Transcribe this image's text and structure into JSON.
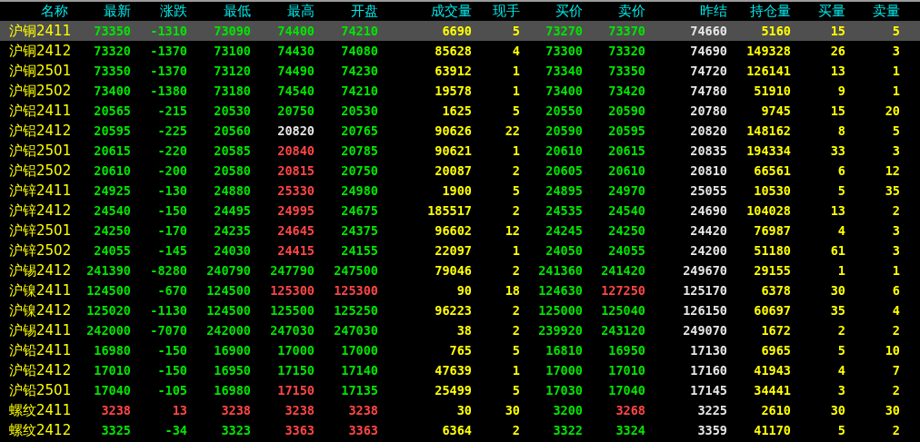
{
  "columns": [
    "名称",
    "最新",
    "涨跌",
    "最低",
    "最高",
    "开盘",
    "成交量",
    "现手",
    "买价",
    "卖价",
    "昨结",
    "持仓量",
    "买量",
    "卖量"
  ],
  "rows": [
    {
      "name": "沪铜2411",
      "selected": true,
      "last": {
        "value": "73350",
        "color": "#00e600"
      },
      "change": {
        "value": "-1310",
        "color": "#00e600"
      },
      "low": {
        "value": "73090",
        "color": "#00e600"
      },
      "high": {
        "value": "74400",
        "color": "#00e600"
      },
      "open": {
        "value": "74210",
        "color": "#00e600"
      },
      "volume": "6690",
      "last_vol": "5",
      "bid": {
        "value": "73270",
        "color": "#00e600"
      },
      "ask": {
        "value": "73370",
        "color": "#00e600"
      },
      "prev_settle": "74660",
      "open_interest": "5160",
      "bid_vol": "15",
      "ask_vol": "5"
    },
    {
      "name": "沪铜2412",
      "selected": false,
      "last": {
        "value": "73320",
        "color": "#00e600"
      },
      "change": {
        "value": "-1370",
        "color": "#00e600"
      },
      "low": {
        "value": "73100",
        "color": "#00e600"
      },
      "high": {
        "value": "74430",
        "color": "#00e600"
      },
      "open": {
        "value": "74080",
        "color": "#00e600"
      },
      "volume": "85628",
      "last_vol": "4",
      "bid": {
        "value": "73300",
        "color": "#00e600"
      },
      "ask": {
        "value": "73320",
        "color": "#00e600"
      },
      "prev_settle": "74690",
      "open_interest": "149328",
      "bid_vol": "26",
      "ask_vol": "3"
    },
    {
      "name": "沪铜2501",
      "selected": false,
      "last": {
        "value": "73350",
        "color": "#00e600"
      },
      "change": {
        "value": "-1370",
        "color": "#00e600"
      },
      "low": {
        "value": "73120",
        "color": "#00e600"
      },
      "high": {
        "value": "74490",
        "color": "#00e600"
      },
      "open": {
        "value": "74230",
        "color": "#00e600"
      },
      "volume": "63912",
      "last_vol": "1",
      "bid": {
        "value": "73340",
        "color": "#00e600"
      },
      "ask": {
        "value": "73350",
        "color": "#00e600"
      },
      "prev_settle": "74720",
      "open_interest": "126141",
      "bid_vol": "13",
      "ask_vol": "1"
    },
    {
      "name": "沪铜2502",
      "selected": false,
      "last": {
        "value": "73400",
        "color": "#00e600"
      },
      "change": {
        "value": "-1380",
        "color": "#00e600"
      },
      "low": {
        "value": "73180",
        "color": "#00e600"
      },
      "high": {
        "value": "74540",
        "color": "#00e600"
      },
      "open": {
        "value": "74210",
        "color": "#00e600"
      },
      "volume": "19578",
      "last_vol": "1",
      "bid": {
        "value": "73400",
        "color": "#00e600"
      },
      "ask": {
        "value": "73420",
        "color": "#00e600"
      },
      "prev_settle": "74780",
      "open_interest": "51910",
      "bid_vol": "9",
      "ask_vol": "1"
    },
    {
      "name": "沪铝2411",
      "selected": false,
      "last": {
        "value": "20565",
        "color": "#00e600"
      },
      "change": {
        "value": "-215",
        "color": "#00e600"
      },
      "low": {
        "value": "20530",
        "color": "#00e600"
      },
      "high": {
        "value": "20750",
        "color": "#00e600"
      },
      "open": {
        "value": "20530",
        "color": "#00e600"
      },
      "volume": "1625",
      "last_vol": "5",
      "bid": {
        "value": "20550",
        "color": "#00e600"
      },
      "ask": {
        "value": "20590",
        "color": "#00e600"
      },
      "prev_settle": "20780",
      "open_interest": "9745",
      "bid_vol": "15",
      "ask_vol": "20"
    },
    {
      "name": "沪铝2412",
      "selected": false,
      "last": {
        "value": "20595",
        "color": "#00e600"
      },
      "change": {
        "value": "-225",
        "color": "#00e600"
      },
      "low": {
        "value": "20560",
        "color": "#00e600"
      },
      "high": {
        "value": "20820",
        "color": "#e6e6e6"
      },
      "open": {
        "value": "20765",
        "color": "#00e600"
      },
      "volume": "90626",
      "last_vol": "22",
      "bid": {
        "value": "20590",
        "color": "#00e600"
      },
      "ask": {
        "value": "20595",
        "color": "#00e600"
      },
      "prev_settle": "20820",
      "open_interest": "148162",
      "bid_vol": "8",
      "ask_vol": "5"
    },
    {
      "name": "沪铝2501",
      "selected": false,
      "last": {
        "value": "20615",
        "color": "#00e600"
      },
      "change": {
        "value": "-220",
        "color": "#00e600"
      },
      "low": {
        "value": "20585",
        "color": "#00e600"
      },
      "high": {
        "value": "20840",
        "color": "#ff4545"
      },
      "open": {
        "value": "20785",
        "color": "#00e600"
      },
      "volume": "90621",
      "last_vol": "1",
      "bid": {
        "value": "20610",
        "color": "#00e600"
      },
      "ask": {
        "value": "20615",
        "color": "#00e600"
      },
      "prev_settle": "20835",
      "open_interest": "194334",
      "bid_vol": "33",
      "ask_vol": "3"
    },
    {
      "name": "沪铝2502",
      "selected": false,
      "last": {
        "value": "20610",
        "color": "#00e600"
      },
      "change": {
        "value": "-200",
        "color": "#00e600"
      },
      "low": {
        "value": "20580",
        "color": "#00e600"
      },
      "high": {
        "value": "20815",
        "color": "#ff4545"
      },
      "open": {
        "value": "20750",
        "color": "#00e600"
      },
      "volume": "20087",
      "last_vol": "2",
      "bid": {
        "value": "20605",
        "color": "#00e600"
      },
      "ask": {
        "value": "20610",
        "color": "#00e600"
      },
      "prev_settle": "20810",
      "open_interest": "66561",
      "bid_vol": "6",
      "ask_vol": "12"
    },
    {
      "name": "沪锌2411",
      "selected": false,
      "last": {
        "value": "24925",
        "color": "#00e600"
      },
      "change": {
        "value": "-130",
        "color": "#00e600"
      },
      "low": {
        "value": "24880",
        "color": "#00e600"
      },
      "high": {
        "value": "25330",
        "color": "#ff4545"
      },
      "open": {
        "value": "24980",
        "color": "#00e600"
      },
      "volume": "1900",
      "last_vol": "5",
      "bid": {
        "value": "24895",
        "color": "#00e600"
      },
      "ask": {
        "value": "24970",
        "color": "#00e600"
      },
      "prev_settle": "25055",
      "open_interest": "10530",
      "bid_vol": "5",
      "ask_vol": "35"
    },
    {
      "name": "沪锌2412",
      "selected": false,
      "last": {
        "value": "24540",
        "color": "#00e600"
      },
      "change": {
        "value": "-150",
        "color": "#00e600"
      },
      "low": {
        "value": "24495",
        "color": "#00e600"
      },
      "high": {
        "value": "24995",
        "color": "#ff4545"
      },
      "open": {
        "value": "24675",
        "color": "#00e600"
      },
      "volume": "185517",
      "last_vol": "2",
      "bid": {
        "value": "24535",
        "color": "#00e600"
      },
      "ask": {
        "value": "24540",
        "color": "#00e600"
      },
      "prev_settle": "24690",
      "open_interest": "104028",
      "bid_vol": "13",
      "ask_vol": "2"
    },
    {
      "name": "沪锌2501",
      "selected": false,
      "last": {
        "value": "24250",
        "color": "#00e600"
      },
      "change": {
        "value": "-170",
        "color": "#00e600"
      },
      "low": {
        "value": "24235",
        "color": "#00e600"
      },
      "high": {
        "value": "24645",
        "color": "#ff4545"
      },
      "open": {
        "value": "24375",
        "color": "#00e600"
      },
      "volume": "96602",
      "last_vol": "12",
      "bid": {
        "value": "24245",
        "color": "#00e600"
      },
      "ask": {
        "value": "24250",
        "color": "#00e600"
      },
      "prev_settle": "24420",
      "open_interest": "76987",
      "bid_vol": "4",
      "ask_vol": "3"
    },
    {
      "name": "沪锌2502",
      "selected": false,
      "last": {
        "value": "24055",
        "color": "#00e600"
      },
      "change": {
        "value": "-145",
        "color": "#00e600"
      },
      "low": {
        "value": "24030",
        "color": "#00e600"
      },
      "high": {
        "value": "24415",
        "color": "#ff4545"
      },
      "open": {
        "value": "24155",
        "color": "#00e600"
      },
      "volume": "22097",
      "last_vol": "1",
      "bid": {
        "value": "24050",
        "color": "#00e600"
      },
      "ask": {
        "value": "24055",
        "color": "#00e600"
      },
      "prev_settle": "24200",
      "open_interest": "51180",
      "bid_vol": "61",
      "ask_vol": "3"
    },
    {
      "name": "沪锡2412",
      "selected": false,
      "last": {
        "value": "241390",
        "color": "#00e600"
      },
      "change": {
        "value": "-8280",
        "color": "#00e600"
      },
      "low": {
        "value": "240790",
        "color": "#00e600"
      },
      "high": {
        "value": "247790",
        "color": "#00e600"
      },
      "open": {
        "value": "247500",
        "color": "#00e600"
      },
      "volume": "79046",
      "last_vol": "2",
      "bid": {
        "value": "241360",
        "color": "#00e600"
      },
      "ask": {
        "value": "241420",
        "color": "#00e600"
      },
      "prev_settle": "249670",
      "open_interest": "29155",
      "bid_vol": "1",
      "ask_vol": "1"
    },
    {
      "name": "沪镍2411",
      "selected": false,
      "last": {
        "value": "124500",
        "color": "#00e600"
      },
      "change": {
        "value": "-670",
        "color": "#00e600"
      },
      "low": {
        "value": "124500",
        "color": "#00e600"
      },
      "high": {
        "value": "125300",
        "color": "#ff4545"
      },
      "open": {
        "value": "125300",
        "color": "#ff4545"
      },
      "volume": "90",
      "last_vol": "18",
      "bid": {
        "value": "124630",
        "color": "#00e600"
      },
      "ask": {
        "value": "127250",
        "color": "#ff4545"
      },
      "prev_settle": "125170",
      "open_interest": "6378",
      "bid_vol": "30",
      "ask_vol": "6"
    },
    {
      "name": "沪镍2412",
      "selected": false,
      "last": {
        "value": "125020",
        "color": "#00e600"
      },
      "change": {
        "value": "-1130",
        "color": "#00e600"
      },
      "low": {
        "value": "124500",
        "color": "#00e600"
      },
      "high": {
        "value": "125500",
        "color": "#00e600"
      },
      "open": {
        "value": "125250",
        "color": "#00e600"
      },
      "volume": "96223",
      "last_vol": "2",
      "bid": {
        "value": "125000",
        "color": "#00e600"
      },
      "ask": {
        "value": "125040",
        "color": "#00e600"
      },
      "prev_settle": "126150",
      "open_interest": "60697",
      "bid_vol": "35",
      "ask_vol": "4"
    },
    {
      "name": "沪锡2411",
      "selected": false,
      "last": {
        "value": "242000",
        "color": "#00e600"
      },
      "change": {
        "value": "-7070",
        "color": "#00e600"
      },
      "low": {
        "value": "242000",
        "color": "#00e600"
      },
      "high": {
        "value": "247030",
        "color": "#00e600"
      },
      "open": {
        "value": "247030",
        "color": "#00e600"
      },
      "volume": "38",
      "last_vol": "2",
      "bid": {
        "value": "239920",
        "color": "#00e600"
      },
      "ask": {
        "value": "243120",
        "color": "#00e600"
      },
      "prev_settle": "249070",
      "open_interest": "1672",
      "bid_vol": "2",
      "ask_vol": "2"
    },
    {
      "name": "沪铅2411",
      "selected": false,
      "last": {
        "value": "16980",
        "color": "#00e600"
      },
      "change": {
        "value": "-150",
        "color": "#00e600"
      },
      "low": {
        "value": "16900",
        "color": "#00e600"
      },
      "high": {
        "value": "17000",
        "color": "#00e600"
      },
      "open": {
        "value": "17000",
        "color": "#00e600"
      },
      "volume": "765",
      "last_vol": "5",
      "bid": {
        "value": "16810",
        "color": "#00e600"
      },
      "ask": {
        "value": "16950",
        "color": "#00e600"
      },
      "prev_settle": "17130",
      "open_interest": "6965",
      "bid_vol": "5",
      "ask_vol": "10"
    },
    {
      "name": "沪铅2412",
      "selected": false,
      "last": {
        "value": "17010",
        "color": "#00e600"
      },
      "change": {
        "value": "-150",
        "color": "#00e600"
      },
      "low": {
        "value": "16950",
        "color": "#00e600"
      },
      "high": {
        "value": "17150",
        "color": "#00e600"
      },
      "open": {
        "value": "17140",
        "color": "#00e600"
      },
      "volume": "47639",
      "last_vol": "1",
      "bid": {
        "value": "17000",
        "color": "#00e600"
      },
      "ask": {
        "value": "17010",
        "color": "#00e600"
      },
      "prev_settle": "17160",
      "open_interest": "41943",
      "bid_vol": "4",
      "ask_vol": "7"
    },
    {
      "name": "沪铅2501",
      "selected": false,
      "last": {
        "value": "17040",
        "color": "#00e600"
      },
      "change": {
        "value": "-105",
        "color": "#00e600"
      },
      "low": {
        "value": "16980",
        "color": "#00e600"
      },
      "high": {
        "value": "17150",
        "color": "#ff4545"
      },
      "open": {
        "value": "17135",
        "color": "#00e600"
      },
      "volume": "25499",
      "last_vol": "5",
      "bid": {
        "value": "17030",
        "color": "#00e600"
      },
      "ask": {
        "value": "17040",
        "color": "#00e600"
      },
      "prev_settle": "17145",
      "open_interest": "34441",
      "bid_vol": "3",
      "ask_vol": "2"
    },
    {
      "name": "螺纹2411",
      "selected": false,
      "last": {
        "value": "3238",
        "color": "#ff4545"
      },
      "change": {
        "value": "13",
        "color": "#ff4545"
      },
      "low": {
        "value": "3238",
        "color": "#ff4545"
      },
      "high": {
        "value": "3238",
        "color": "#ff4545"
      },
      "open": {
        "value": "3238",
        "color": "#ff4545"
      },
      "volume": "30",
      "last_vol": "30",
      "bid": {
        "value": "3200",
        "color": "#00e600"
      },
      "ask": {
        "value": "3268",
        "color": "#ff4545"
      },
      "prev_settle": "3225",
      "open_interest": "2610",
      "bid_vol": "30",
      "ask_vol": "30"
    },
    {
      "name": "螺纹2412",
      "selected": false,
      "last": {
        "value": "3325",
        "color": "#00e600"
      },
      "change": {
        "value": "-34",
        "color": "#00e600"
      },
      "low": {
        "value": "3323",
        "color": "#00e600"
      },
      "high": {
        "value": "3363",
        "color": "#ff4545"
      },
      "open": {
        "value": "3363",
        "color": "#ff4545"
      },
      "volume": "6364",
      "last_vol": "2",
      "bid": {
        "value": "3322",
        "color": "#00e600"
      },
      "ask": {
        "value": "3324",
        "color": "#00e600"
      },
      "prev_settle": "3359",
      "open_interest": "41170",
      "bid_vol": "5",
      "ask_vol": "2"
    }
  ]
}
